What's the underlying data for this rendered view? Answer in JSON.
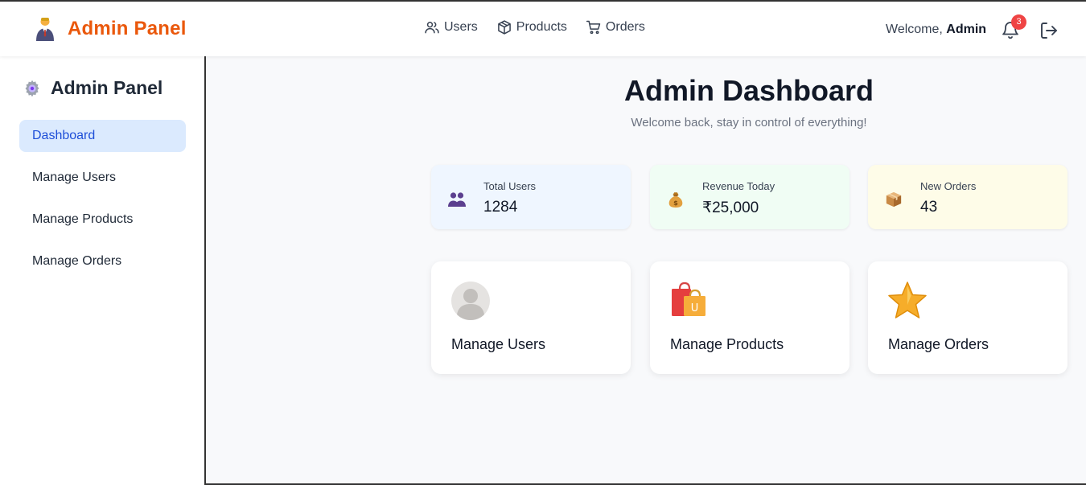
{
  "header": {
    "brand": "Admin Panel",
    "brand_icon": "businessman-icon",
    "nav": [
      {
        "label": "Users",
        "icon": "users-icon"
      },
      {
        "label": "Products",
        "icon": "box-icon"
      },
      {
        "label": "Orders",
        "icon": "cart-icon"
      }
    ],
    "welcome_prefix": "Welcome,",
    "welcome_user": "Admin",
    "notification_count": "3",
    "accent_color": "#ea580c"
  },
  "sidebar": {
    "title": "Admin Panel",
    "title_icon": "gear-icon",
    "items": [
      {
        "label": "Dashboard",
        "active": true
      },
      {
        "label": "Manage Users"
      },
      {
        "label": "Manage Products"
      },
      {
        "label": "Manage Orders"
      }
    ],
    "active_color": "#1d4ed8"
  },
  "main": {
    "title": "Admin Dashboard",
    "subtitle": "Welcome back, stay in control of everything!",
    "stats": [
      {
        "label": "Total Users",
        "value": "1284",
        "icon": "users-emoji-icon",
        "bg": "#eff6ff"
      },
      {
        "label": "Revenue Today",
        "value": "₹25,000",
        "icon": "money-bag-icon",
        "bg": "#f0fdf4"
      },
      {
        "label": "New Orders",
        "value": "43",
        "icon": "package-icon",
        "bg": "#fefce8"
      }
    ],
    "cards": [
      {
        "label": "Manage Users",
        "icon": "avatar-icon"
      },
      {
        "label": "Manage Products",
        "icon": "shopping-bags-icon"
      },
      {
        "label": "Manage Orders",
        "icon": "star-icon"
      }
    ]
  }
}
